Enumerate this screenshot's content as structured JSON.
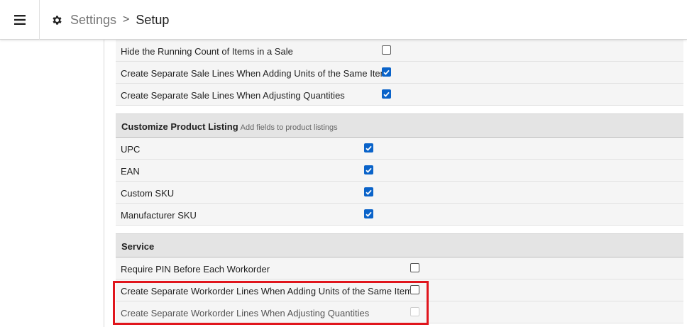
{
  "header": {
    "breadcrumb_parent": "Settings",
    "breadcrumb_separator": ">",
    "breadcrumb_current": "Setup"
  },
  "sale_rows": [
    {
      "label": "Hide the Running Count of Items in a Sale",
      "checked": false
    },
    {
      "label": "Create Separate Sale Lines When Adding Units of the Same Item",
      "checked": true
    },
    {
      "label": "Create Separate Sale Lines When Adjusting Quantities",
      "checked": true
    }
  ],
  "product_listing": {
    "title": "Customize Product Listing",
    "subtitle": "Add fields to product listings",
    "rows": [
      {
        "label": "UPC",
        "checked": true
      },
      {
        "label": "EAN",
        "checked": true
      },
      {
        "label": "Custom SKU",
        "checked": true
      },
      {
        "label": "Manufacturer SKU",
        "checked": true
      }
    ]
  },
  "service": {
    "title": "Service",
    "rows": [
      {
        "label": "Require PIN Before Each Workorder",
        "checked": false,
        "disabled": false
      },
      {
        "label": "Create Separate Workorder Lines When Adding Units of the Same Item",
        "checked": false,
        "disabled": false
      },
      {
        "label": "Create Separate Workorder Lines When Adjusting Quantities",
        "checked": false,
        "disabled": true
      }
    ]
  },
  "colors": {
    "checkbox_checked": "#0a63c9",
    "highlight_border": "#e0151c",
    "section_header_bg": "#e4e4e4",
    "row_bg": "#f5f5f5"
  },
  "icons": {
    "menu": "hamburger-menu-icon",
    "settings": "gear-icon",
    "separator": "chevron-right-icon",
    "check": "checkmark-icon"
  }
}
